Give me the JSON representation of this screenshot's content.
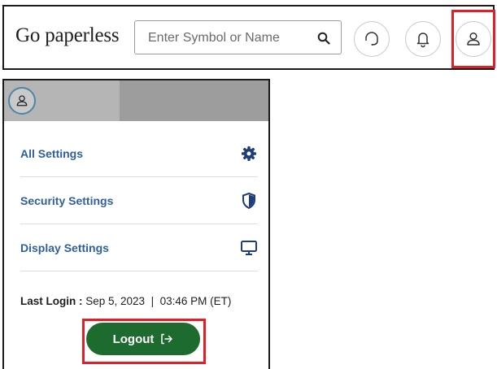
{
  "header": {
    "brand": "Go paperless",
    "search": {
      "placeholder": "Enter Symbol or Name",
      "value": ""
    },
    "icons": [
      "search-icon",
      "headset-icon",
      "bell-icon",
      "user-icon"
    ]
  },
  "menu": {
    "items": [
      {
        "label": "All Settings",
        "icon": "gear-icon"
      },
      {
        "label": "Security Settings",
        "icon": "shield-icon"
      },
      {
        "label": "Display Settings",
        "icon": "monitor-icon"
      }
    ],
    "last_login_label": "Last Login :",
    "last_login_value": " Sep 5, 2023  |  03:46 PM (ET)",
    "logout_label": "Logout"
  },
  "colors": {
    "accent_blue": "#2f5f9c",
    "logout_green": "#1e6b2f",
    "highlight_red": "#e21f26",
    "panel_header_gray": "#b5b5b5"
  }
}
